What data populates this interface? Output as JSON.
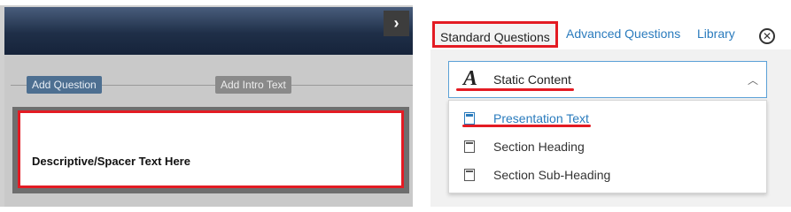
{
  "editor": {
    "add_question_label": "Add Question",
    "add_intro_text_label": "Add Intro Text",
    "question_text": "Descriptive/Spacer Text Here",
    "collapse_icon": "chevron-right-icon"
  },
  "panel": {
    "tabs": [
      {
        "label": "Standard Questions",
        "active": true
      },
      {
        "label": "Advanced Questions",
        "active": false
      },
      {
        "label": "Library",
        "active": false
      }
    ],
    "close_icon": "close-circle-icon",
    "category_select": {
      "icon_glyph": "A",
      "selected": "Static Content",
      "chevron_icon": "chevron-up-icon"
    },
    "options": [
      {
        "label": "Presentation Text",
        "icon": "presentation-text-icon",
        "selected": true
      },
      {
        "label": "Section Heading",
        "icon": "section-heading-icon",
        "selected": false
      },
      {
        "label": "Section Sub-Heading",
        "icon": "section-subheading-icon",
        "selected": false
      }
    ]
  },
  "colors": {
    "accent": "#2a7bbd",
    "highlight": "#e31b23",
    "header": "#1f2f48"
  }
}
